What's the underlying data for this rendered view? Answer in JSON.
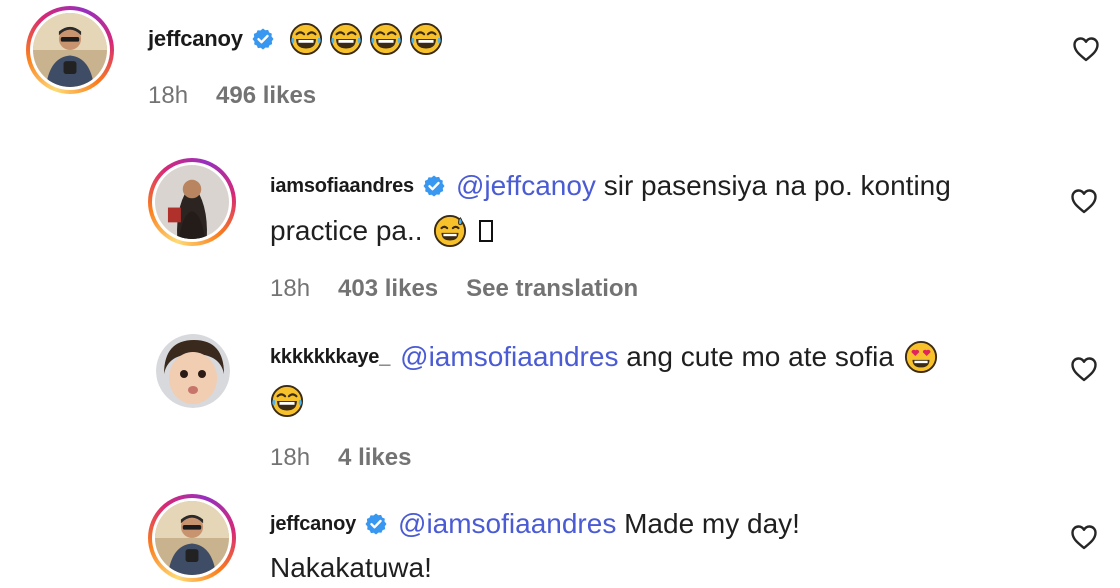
{
  "comments": [
    {
      "username": "jeffcanoy",
      "mention": "",
      "text": "",
      "emojis": [
        "joy-emoji",
        "joy-emoji",
        "joy-emoji",
        "joy-emoji"
      ],
      "time": "18h",
      "likes": "496 likes"
    },
    {
      "username": "iamsofiaandres",
      "mention": "@jeffcanoy",
      "text": " sir pasensiya na po. konting",
      "text_line2": "practice pa..",
      "time": "18h",
      "likes": "403 likes",
      "see_translation": "See translation"
    },
    {
      "username": "kkkkkkkaye_",
      "mention": "@iamsofiaandres",
      "text": " ang cute mo ate sofia",
      "time": "18h",
      "likes": "4 likes"
    },
    {
      "username": "jeffcanoy",
      "mention": "@iamsofiaandres",
      "text": " Made my day!",
      "text_line2": "Nakakatuwa!"
    }
  ],
  "colors": {
    "mention": "#4a5bd4",
    "meta": "#737373",
    "verified": "#3897f0"
  },
  "icons": {
    "like": "heart-outline-icon",
    "verified": "verified-badge-icon"
  }
}
